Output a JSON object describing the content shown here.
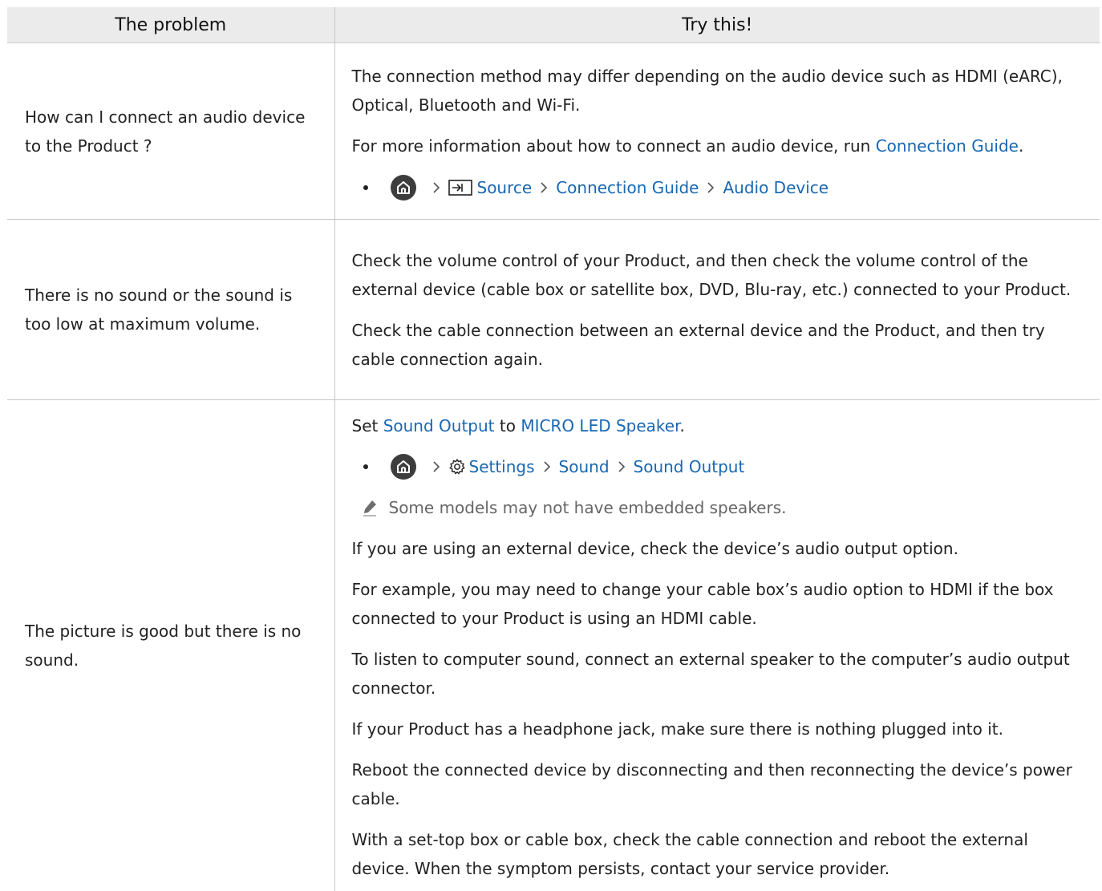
{
  "header": {
    "problem": "The problem",
    "try_this": "Try this!"
  },
  "rows": [
    {
      "problem": "How can I connect an audio device to the Product ?",
      "p1": "The connection method may differ depending on the audio device such as HDMI (eARC), Optical, Bluetooth and Wi-Fi.",
      "p2_prefix": "For more information about how to connect an audio device, run ",
      "p2_link": "Connection Guide",
      "p2_suffix": ".",
      "path": [
        "Source",
        "Connection Guide",
        "Audio Device"
      ]
    },
    {
      "problem": "There is no sound or the sound is too low at maximum volume.",
      "p1": "Check the volume control of your Product, and then check the volume control of the external device (cable box or satellite box, DVD, Blu-ray, etc.) connected to your Product.",
      "p2": "Check the cable connection between an external device and the Product, and then try cable connection again."
    },
    {
      "problem": "The picture is good but there is no sound.",
      "set_prefix": "Set ",
      "set_link1": "Sound Output",
      "set_mid": " to ",
      "set_link2": "MICRO LED Speaker",
      "set_suffix": ".",
      "path": [
        "Settings",
        "Sound",
        "Sound Output"
      ],
      "note": "Some models may not have embedded speakers.",
      "p3": "If you are using an external device, check the device’s audio output option.",
      "p4": "For example, you may need to change your cable box’s audio option to HDMI if the box connected to your Product is using an HDMI cable.",
      "p5": "To listen to computer sound, connect an external speaker to the computer’s audio output connector.",
      "p6": "If your Product has a headphone jack, make sure there is nothing plugged into it.",
      "p7": "Reboot the connected device by disconnecting and then reconnecting the device’s power cable.",
      "p8": "With a set-top box or cable box, check the cable connection and reboot the external device. When the symptom persists, contact your service provider."
    }
  ],
  "icons": {
    "home": "home-icon",
    "source": "source-icon",
    "settings": "gear-icon",
    "chevron": "chevron-right-icon",
    "note": "pencil-note-icon"
  },
  "colors": {
    "link": "#1967b2",
    "header_bg": "#ebebeb",
    "border": "#c7c7c7",
    "note_text": "#666666"
  }
}
